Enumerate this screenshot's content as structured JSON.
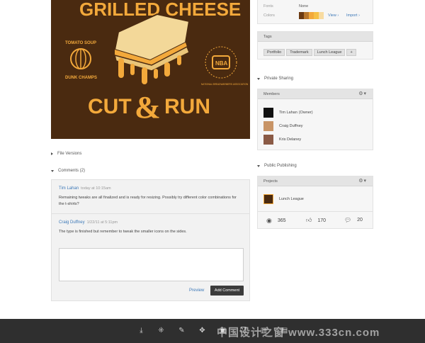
{
  "artwork": {
    "title_top": "GRILLED CHEESE",
    "title_bottom_left": "CUT",
    "title_bottom_amp": "&",
    "title_bottom_right": "RUN",
    "badge_left_top": "TOMATO SOUP",
    "badge_left_bottom": "DUNK CHAMPS",
    "badge_right_arc": "NATIONAL BREADWARMERS ASSOCIATION",
    "badge_right_center": "NBA",
    "colors": {
      "background": "#4a2a10",
      "accent": "#f3a93b",
      "cheese": "#f6c046",
      "bread": "#f3d899"
    }
  },
  "left": {
    "file_versions": "File Versions",
    "comments_header": "Comments (2)",
    "comments": [
      {
        "author": "Tim Lahan",
        "date": "today at 10:15am",
        "text": "Remaining tweaks are all finalized and is ready for resizing. Possibly try different color combinations for the t-shirts?"
      },
      {
        "author": "Craig Duffney",
        "date": "1/22/11 at 5:11pm",
        "text": "The type is finished but remember to tweak the smaller icons on the sides."
      }
    ],
    "preview_label": "Preview",
    "add_comment_label": "Add Comment"
  },
  "right": {
    "fonts_label": "Fonts",
    "fonts_value": "None",
    "colors_label": "Colors",
    "swatches": [
      "#6b3a12",
      "#b8762c",
      "#f3a93b",
      "#f6c046",
      "#f8dba0"
    ],
    "view_label": "View ›",
    "import_label": "Import ›",
    "tags_header": "Tags",
    "tags": [
      "Portfolio",
      "Trademark",
      "Lunch League"
    ],
    "add_tag": "+",
    "private_sharing": "Private Sharing",
    "members_header": "Members",
    "members": [
      {
        "name": "Tim Lahan",
        "role": "(Owner)"
      },
      {
        "name": "Craig Duffney",
        "role": ""
      },
      {
        "name": "Kris Delaney",
        "role": ""
      }
    ],
    "public_publishing": "Public Publishing",
    "projects_header": "Projects",
    "project_name": "Lunch League",
    "stats": {
      "views": "365",
      "likes": "170",
      "comments": "20"
    }
  },
  "toolbar": {
    "icons": [
      "download-icon",
      "share-icon",
      "pen-icon",
      "move-icon",
      "folder-icon",
      "copy-icon",
      "trash-icon",
      "archive-icon"
    ],
    "watermark": "中国设计之窗 www.333cn.com"
  }
}
